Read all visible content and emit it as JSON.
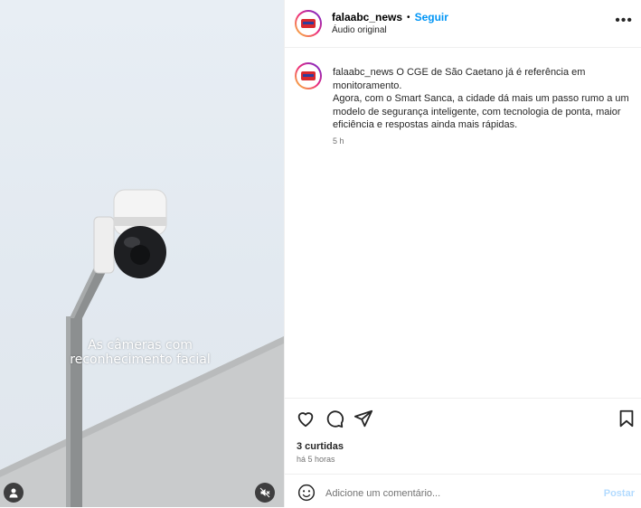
{
  "post": {
    "username": "falaabc_news",
    "separator": "•",
    "follow_label": "Seguir",
    "audio_label": "Áudio original",
    "more_label": "•••",
    "caption_username": "falaabc_news",
    "caption_line1": "O CGE de São Caetano já é referência em monitoramento.",
    "caption_line2": "Agora, com o Smart Sanca, a cidade dá mais um passo rumo a um modelo de segurança inteligente, com tecnologia de ponta, maior eficiência e respostas ainda mais rápidas.",
    "caption_time": "5 h",
    "likes": "3 curtidas",
    "posted_ago": "há 5 horas",
    "comment_placeholder": "Adicione um comentário...",
    "post_label": "Postar"
  },
  "video": {
    "subtitle_line1": "As câmeras com",
    "subtitle_line2": "reconhecimento facial"
  },
  "colors": {
    "follow": "#0095f6",
    "post_disabled": "#b3dbff",
    "sky": "#e4ebf2"
  },
  "icons": {
    "heart": "heart-icon",
    "comment": "comment-icon",
    "share": "share-icon",
    "save": "bookmark-icon",
    "emoji": "emoji-icon",
    "mute": "muted-speaker-icon",
    "user": "user-tag-icon"
  }
}
